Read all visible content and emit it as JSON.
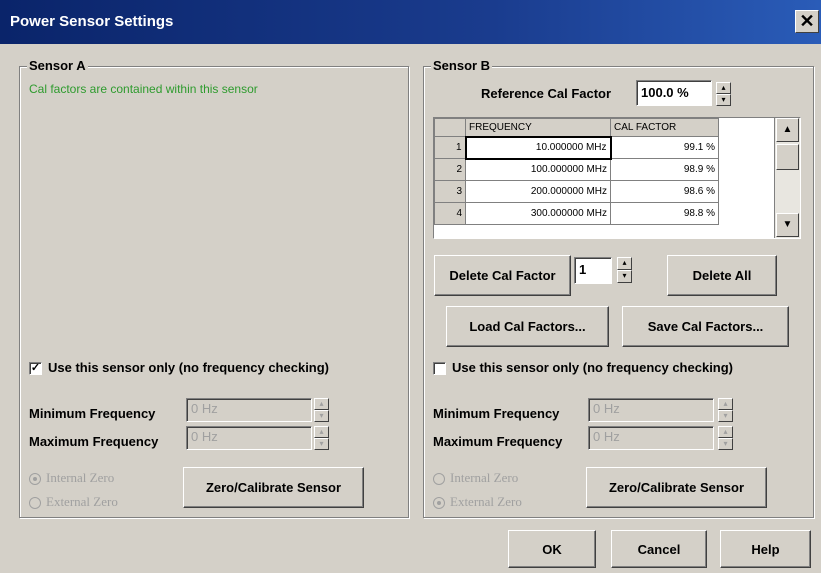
{
  "window": {
    "title": "Power Sensor Settings",
    "close_glyph": "✕"
  },
  "sensor_a": {
    "title": "Sensor A",
    "note": "Cal factors are contained within this sensor",
    "use_only_label": "Use this sensor only (no frequency checking)",
    "use_only_checked": true,
    "check_glyph": "✓",
    "min_freq_label": "Minimum Frequency",
    "min_freq_value": "0 Hz",
    "max_freq_label": "Maximum Frequency",
    "max_freq_value": "0 Hz",
    "internal_zero_label": "Internal Zero",
    "external_zero_label": "External Zero",
    "zero_selected": "internal",
    "zero_cal_button": "Zero/Calibrate Sensor"
  },
  "sensor_b": {
    "title": "Sensor B",
    "ref_cal_label": "Reference Cal Factor",
    "ref_cal_value": "100.0 %",
    "table": {
      "headers": [
        "FREQUENCY",
        "CAL FACTOR"
      ],
      "rows": [
        {
          "n": "1",
          "freq": "10.000000 MHz",
          "cal": "99.1 %"
        },
        {
          "n": "2",
          "freq": "100.000000 MHz",
          "cal": "98.9 %"
        },
        {
          "n": "3",
          "freq": "200.000000 MHz",
          "cal": "98.6 %"
        },
        {
          "n": "4",
          "freq": "300.000000 MHz",
          "cal": "98.8 %"
        }
      ]
    },
    "delete_cal_button": "Delete Cal Factor",
    "delete_index": "1",
    "delete_all_button": "Delete All",
    "load_button": "Load Cal Factors...",
    "save_button": "Save Cal Factors...",
    "use_only_label": "Use this sensor only (no frequency checking)",
    "use_only_checked": false,
    "min_freq_label": "Minimum Frequency",
    "min_freq_value": "0 Hz",
    "max_freq_label": "Maximum Frequency",
    "max_freq_value": "0 Hz",
    "internal_zero_label": "Internal Zero",
    "external_zero_label": "External Zero",
    "zero_selected": "external",
    "zero_cal_button": "Zero/Calibrate Sensor"
  },
  "footer": {
    "ok": "OK",
    "cancel": "Cancel",
    "help": "Help"
  },
  "glyphs": {
    "up": "▲",
    "down": "▼",
    "spin_up": "▴",
    "spin_down": "▾"
  },
  "colors": {
    "titlebar": "#0a246a",
    "face": "#d4d0c8",
    "note_green": "#2e9b2e"
  }
}
